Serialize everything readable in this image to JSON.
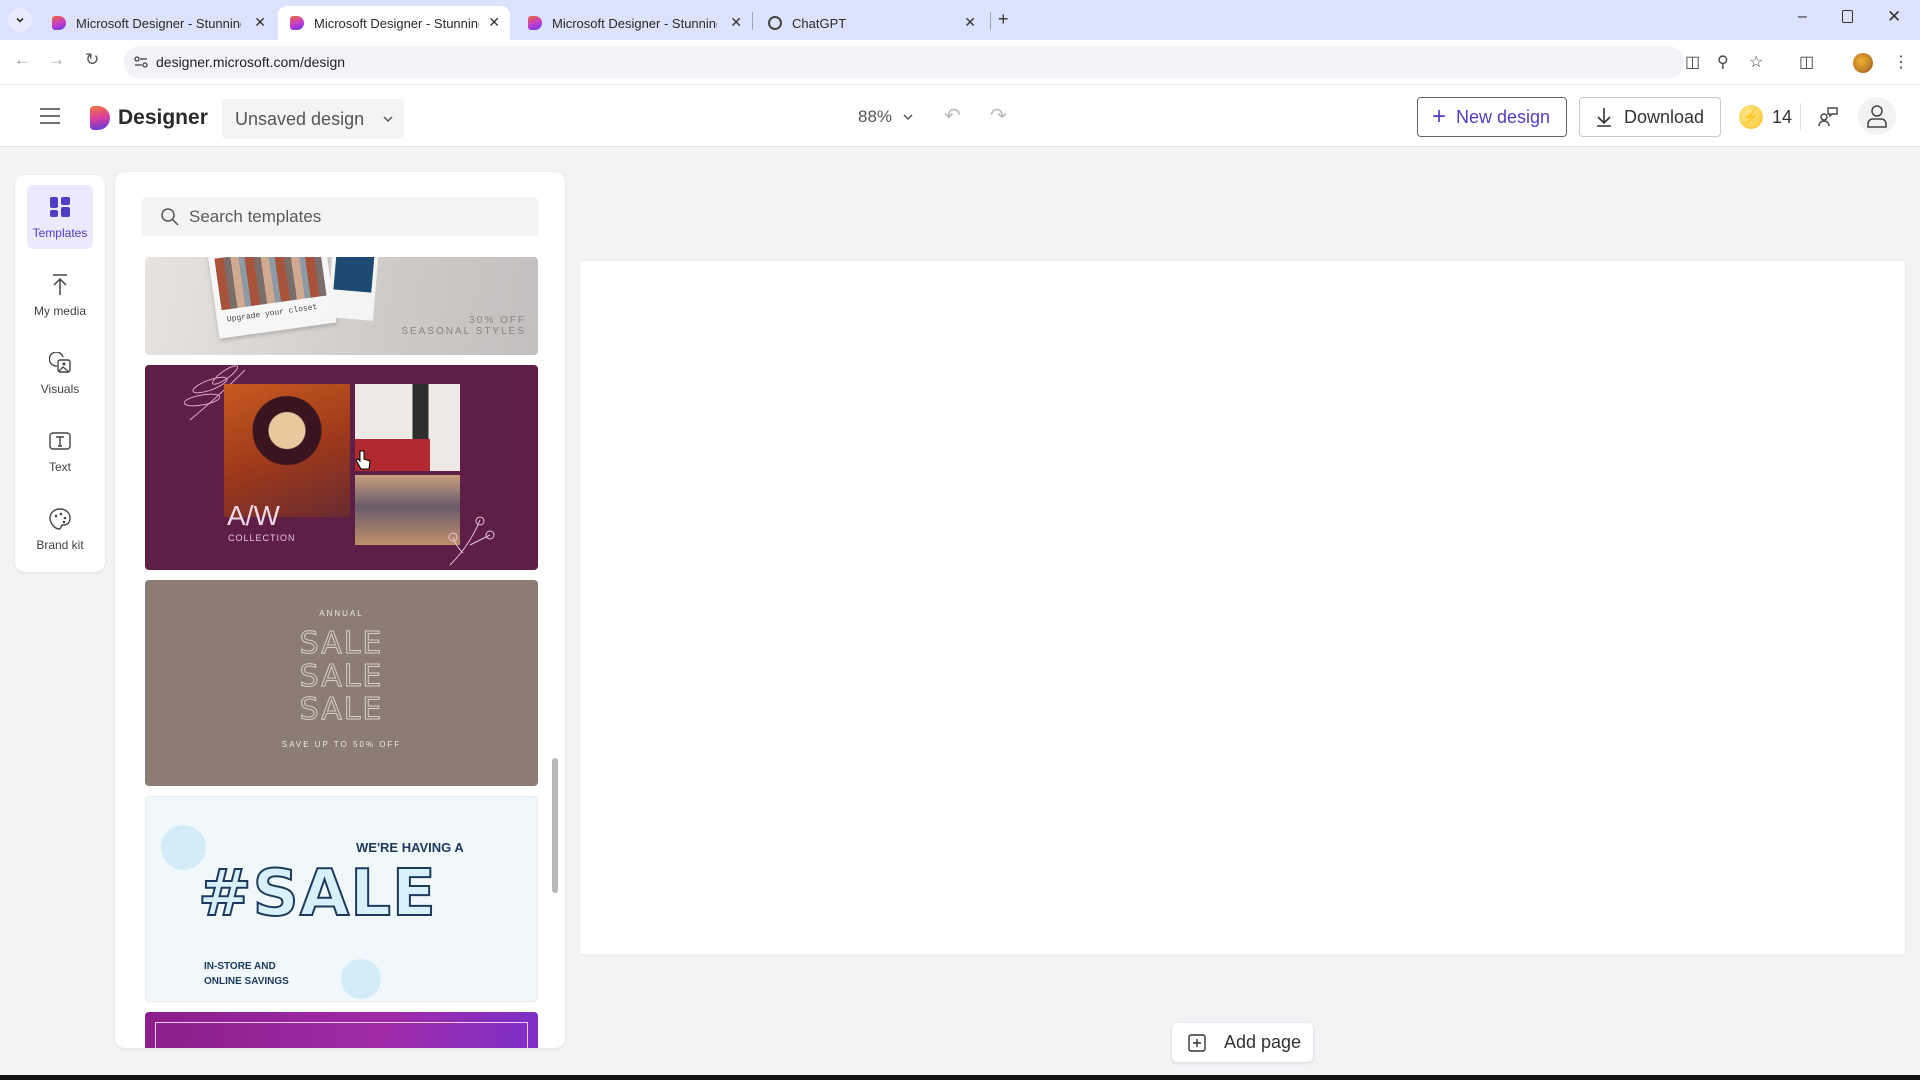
{
  "browser": {
    "tabs": [
      {
        "title": "Microsoft Designer - Stunning designs in a flash",
        "active": false
      },
      {
        "title": "Microsoft Designer - Stunning designs in a flash",
        "active": true
      },
      {
        "title": "Microsoft Designer - Stunning designs in a flash",
        "active": false
      },
      {
        "title": "ChatGPT",
        "active": false
      }
    ],
    "url": "designer.microsoft.com/design",
    "close_glyph": "✕",
    "new_tab_glyph": "+"
  },
  "header": {
    "app_name": "Designer",
    "design_name": "Unsaved design",
    "zoom": "88%",
    "new_design_label": "New design",
    "download_label": "Download",
    "credits": "14"
  },
  "rail": {
    "items": [
      {
        "label": "Templates",
        "icon": "templates-icon",
        "active": true
      },
      {
        "label": "My media",
        "icon": "upload-icon",
        "active": false
      },
      {
        "label": "Visuals",
        "icon": "visuals-icon",
        "active": false
      },
      {
        "label": "Text",
        "icon": "text-icon",
        "active": false
      },
      {
        "label": "Brand kit",
        "icon": "palette-icon",
        "active": false
      }
    ]
  },
  "panel": {
    "search_placeholder": "Search templates",
    "templates": [
      {
        "name": "seasonal-styles",
        "caption": "Upgrade your closet",
        "line1": "30% OFF",
        "line2": "SEASONAL STYLES"
      },
      {
        "name": "aw-collection",
        "title": "A/W",
        "subtitle": "COLLECTION"
      },
      {
        "name": "annual-sale",
        "top": "ANNUAL",
        "word": "SALE",
        "bottom": "SAVE UP TO 50% OFF"
      },
      {
        "name": "pet-sale",
        "top": "WE'RE HAVING A",
        "word": "#SALE",
        "bottom1": "IN-STORE AND",
        "bottom2": "ONLINE SAVINGS"
      },
      {
        "name": "purple-template"
      }
    ]
  },
  "canvas": {
    "add_page_label": "Add page"
  },
  "colors": {
    "accent": "#4f3ec4",
    "tab_bar": "#dbe2fb",
    "aw_bg": "#5e1f47",
    "annual_bg": "#8c7d74",
    "pet_text": "#1d3a5c"
  }
}
